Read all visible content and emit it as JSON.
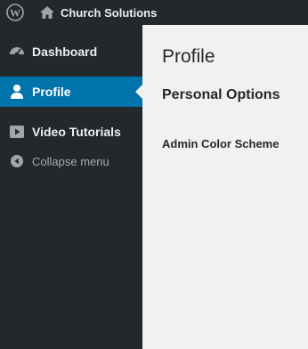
{
  "adminbar": {
    "site_name": "Church Solutions"
  },
  "sidebar": {
    "items": [
      {
        "label": "Dashboard",
        "icon": "dashboard-icon"
      },
      {
        "label": "Profile",
        "icon": "user-icon",
        "current": true
      },
      {
        "label": "Video Tutorials",
        "icon": "video-icon"
      }
    ],
    "collapse_label": "Collapse menu"
  },
  "main": {
    "page_title": "Profile",
    "section_title": "Personal Options",
    "field_label": "Admin Color Scheme"
  },
  "colors": {
    "adminbar_bg": "#23282d",
    "sidebar_bg": "#23282d",
    "accent": "#0073aa",
    "content_bg": "#f1f1f1"
  }
}
